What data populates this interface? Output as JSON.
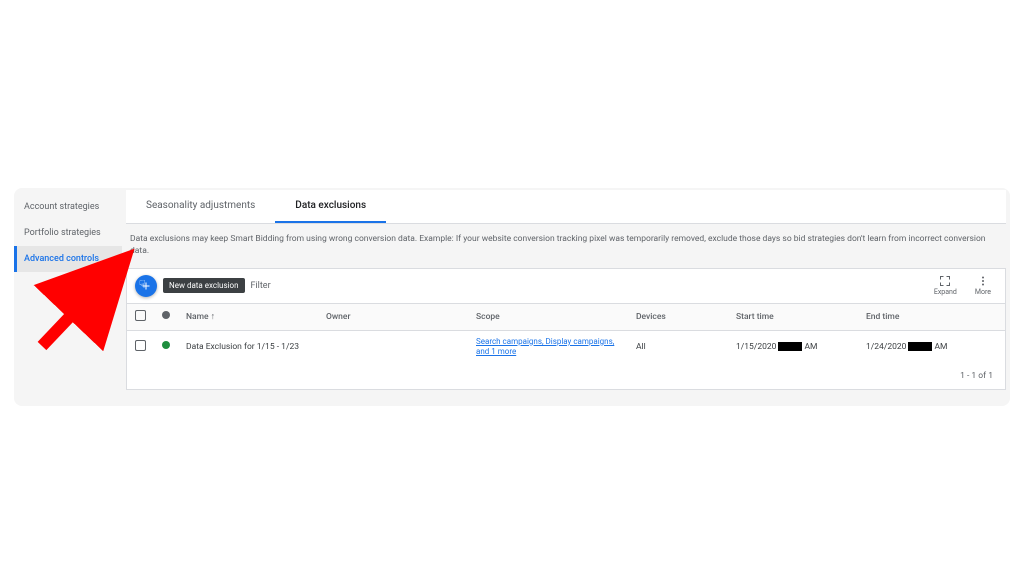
{
  "sidebar": {
    "items": [
      {
        "label": "Account strategies"
      },
      {
        "label": "Portfolio strategies"
      },
      {
        "label": "Advanced controls"
      }
    ]
  },
  "tabs": [
    {
      "label": "Seasonality adjustments"
    },
    {
      "label": "Data exclusions"
    }
  ],
  "description": "Data exclusions may keep Smart Bidding from using wrong conversion data. Example: If your website conversion tracking pixel was temporarily removed, exclude those days so bid strategies don't learn from incorrect conversion data.",
  "toolbar": {
    "tooltip": "New data exclusion",
    "filter_label": "Filter",
    "expand_label": "Expand",
    "more_label": "More"
  },
  "table": {
    "headers": {
      "name": "Name",
      "owner": "Owner",
      "scope": "Scope",
      "devices": "Devices",
      "start": "Start time",
      "end": "End time"
    },
    "rows": [
      {
        "name": "Data Exclusion for 1/15 - 1/23",
        "owner": "",
        "scope": "Search campaigns, Display campaigns, and 1 more",
        "devices": "All",
        "start_date": "1/15/2020",
        "start_suffix": "AM",
        "end_date": "1/24/2020",
        "end_suffix": "AM"
      }
    ]
  },
  "pagination": "1 - 1 of 1"
}
